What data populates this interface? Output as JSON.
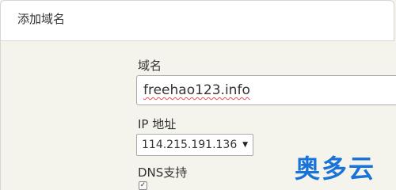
{
  "dialog": {
    "title": "添加域名"
  },
  "form": {
    "domain_label": "域名",
    "domain_value": "freehao123.info",
    "ip_label": "IP 地址",
    "ip_selected": "114.215.191.136",
    "dns_label": "DNS支持",
    "dns_checked": true
  },
  "icons": {
    "select_arrow": "chevron-down-icon",
    "checkbox_check": "checkmark-icon"
  },
  "watermark": "奥多云",
  "colors": {
    "watermark": "#1a73d9",
    "panel_bg": "#f4f4ec",
    "spellcheck": "#e05050"
  }
}
